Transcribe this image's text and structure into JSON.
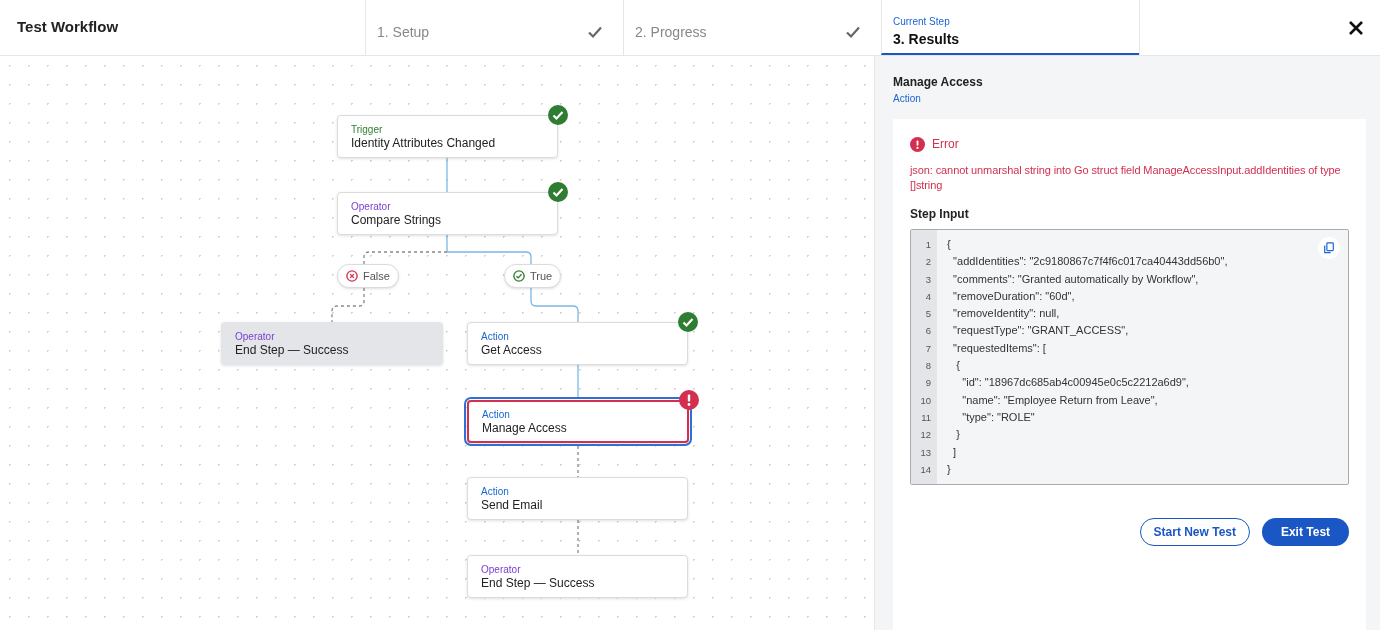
{
  "header": {
    "title": "Test Workflow",
    "steps": [
      {
        "label": "1. Setup",
        "completed": true,
        "selected": false
      },
      {
        "label": "2. Progress",
        "completed": true,
        "selected": false
      },
      {
        "label": "3. Results",
        "completed": false,
        "selected": true,
        "caption": "Current Step"
      }
    ]
  },
  "nodes": [
    {
      "kind": "trigger",
      "type_label": "Trigger",
      "name": "Identity Attributes Changed",
      "succeeded": true,
      "failed": false,
      "selected": false,
      "disabled": false
    },
    {
      "kind": "operator",
      "type_label": "Operator",
      "name": "Compare Strings",
      "succeeded": true,
      "failed": false,
      "selected": false,
      "disabled": false
    },
    {
      "kind": "operator",
      "type_label": "Operator",
      "name": "End Step — Success",
      "succeeded": false,
      "failed": false,
      "selected": false,
      "disabled": true
    },
    {
      "kind": "action",
      "type_label": "Action",
      "name": "Get Access",
      "succeeded": true,
      "failed": false,
      "selected": false,
      "disabled": false
    },
    {
      "kind": "action",
      "type_label": "Action",
      "name": "Manage Access",
      "succeeded": false,
      "failed": true,
      "selected": true,
      "disabled": false
    },
    {
      "kind": "action",
      "type_label": "Action",
      "name": "Send Email",
      "succeeded": false,
      "failed": false,
      "selected": false,
      "disabled": false
    },
    {
      "kind": "operator",
      "type_label": "Operator",
      "name": "End Step — Success",
      "succeeded": false,
      "failed": false,
      "selected": false,
      "disabled": false
    }
  ],
  "branches": [
    {
      "label": "False",
      "result": false
    },
    {
      "label": "True",
      "result": true
    }
  ],
  "panel": {
    "title": "Manage Access",
    "subtitle": "Action",
    "error_label": "Error",
    "error_message": "json: cannot unmarshal string into Go struct field ManageAccessInput.addIdentities of type []string",
    "input_heading": "Step Input",
    "code_lines": [
      {
        "number": "1",
        "text": "{"
      },
      {
        "number": "2",
        "text": "  \"addIdentities\": \"2c9180867c7f4f6c017ca40443dd56b0\","
      },
      {
        "number": "3",
        "text": "  \"comments\": \"Granted automatically by Workflow\","
      },
      {
        "number": "4",
        "text": "  \"removeDuration\": \"60d\","
      },
      {
        "number": "5",
        "text": "  \"removeIdentity\": null,"
      },
      {
        "number": "6",
        "text": "  \"requestType\": \"GRANT_ACCESS\","
      },
      {
        "number": "7",
        "text": "  \"requestedItems\": ["
      },
      {
        "number": "8",
        "text": "   {"
      },
      {
        "number": "9",
        "text": "     \"id\": \"18967dc685ab4c00945e0c5c2212a6d9\","
      },
      {
        "number": "10",
        "text": "     \"name\": \"Employee Return from Leave\","
      },
      {
        "number": "11",
        "text": "     \"type\": \"ROLE\""
      },
      {
        "number": "12",
        "text": "   }"
      },
      {
        "number": "13",
        "text": "  ]"
      },
      {
        "number": "14",
        "text": "}"
      }
    ],
    "buttons": [
      {
        "label": "Start New Test",
        "kind": "secondary"
      },
      {
        "label": "Exit Test",
        "kind": "primary"
      }
    ]
  }
}
